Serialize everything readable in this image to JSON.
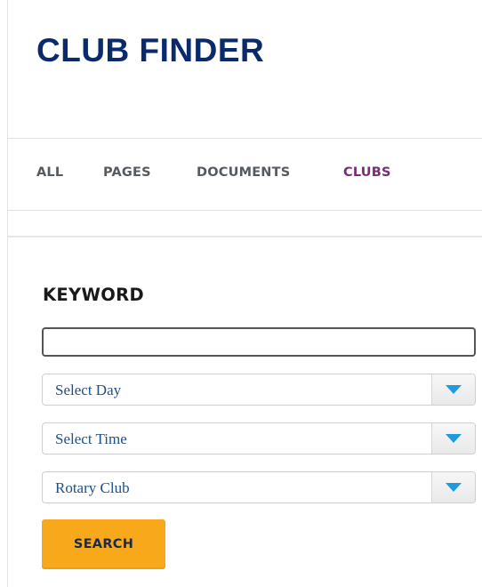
{
  "header": {
    "title": "CLUB FINDER"
  },
  "tabs": [
    {
      "label": "ALL",
      "active": false
    },
    {
      "label": "PAGES",
      "active": false
    },
    {
      "label": "DOCUMENTS",
      "active": false
    },
    {
      "label": "CLUBS",
      "active": true
    }
  ],
  "form": {
    "keyword_label": "KEYWORD",
    "keyword_value": "",
    "keyword_placeholder": "",
    "day_select": {
      "value": "Select Day"
    },
    "time_select": {
      "value": "Select Time"
    },
    "type_select": {
      "value": "Rotary Club"
    },
    "search_label": "SEARCH"
  },
  "icons": {
    "dropdown": "chevron-down-icon"
  },
  "colors": {
    "title": "#0b2a6b",
    "active_tab": "#7b2a7a",
    "tab": "#555a60",
    "select_text": "#1d4f8c",
    "dropdown_arrow": "#1e9be0",
    "search_button": "#f7a81b"
  }
}
